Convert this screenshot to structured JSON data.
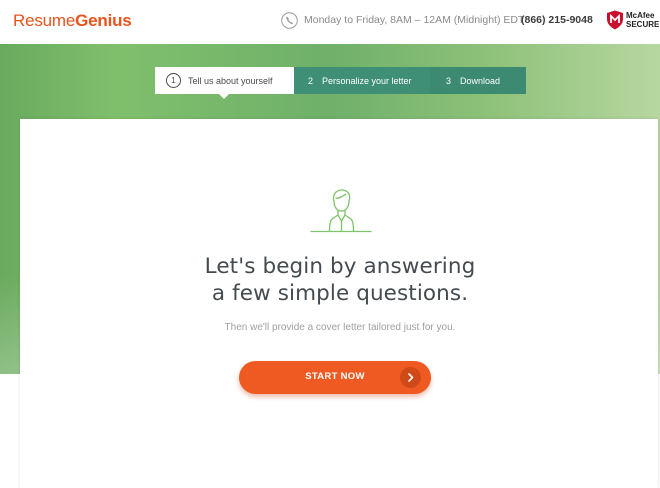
{
  "brand": {
    "logo_part1": "Resume",
    "logo_part2": "Genius",
    "accent": "#e8541e"
  },
  "header": {
    "hours": "Monday to Friday, 8AM – 12AM (Midnight) EDT",
    "phone": "(866) 215-9048",
    "phone_icon": "phone-icon",
    "badge_line1": "McAfee",
    "badge_line2": "SECURE"
  },
  "steps": [
    {
      "number": "1",
      "label": "Tell us about yourself",
      "active": true
    },
    {
      "number": "2",
      "label": "Personalize your letter",
      "active": false
    },
    {
      "number": "3",
      "label": "Download",
      "active": false
    }
  ],
  "main": {
    "headline_line1": "Let's begin by answering",
    "headline_line2": "a few simple questions.",
    "subtext": "Then we'll provide a cover letter tailored just for you.",
    "cta_label": "START NOW",
    "cta_icon": "chevron-right-icon",
    "cta_color": "#ee5a22"
  },
  "colors": {
    "hero_green": "#6fb06a",
    "step_green": "#3f8f76",
    "avatar_green": "#7cc36a"
  }
}
